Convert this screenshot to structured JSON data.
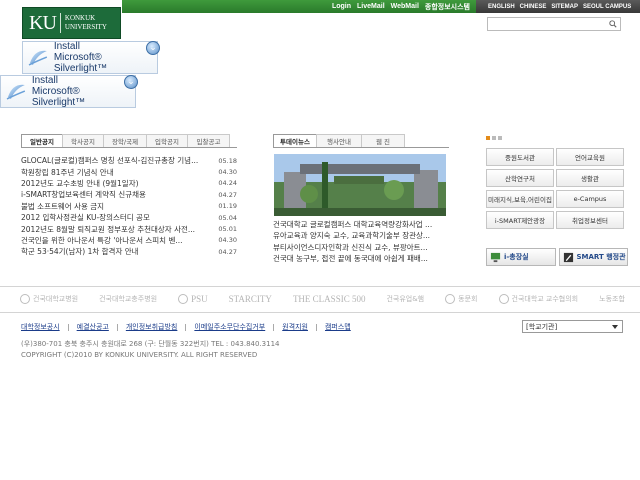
{
  "top_nav": {
    "links": [
      "Login",
      "LiveMail",
      "WebMail",
      "종합정보시스템"
    ],
    "lang_links": [
      "ENGLISH",
      "CHINESE",
      "SITEMAP",
      "SEOUL CAMPUS"
    ]
  },
  "logo": {
    "initials": "KU",
    "name_line1": "KONKUK",
    "name_line2": "UNIVERSITY"
  },
  "search": {
    "value": "",
    "placeholder": ""
  },
  "silverlight": {
    "line1": "Install",
    "line2": "Microsoft® Silverlight™"
  },
  "notice": {
    "tabs": [
      "일반공지",
      "학사공지",
      "장학/국제",
      "입학공지",
      "입찰공고"
    ],
    "items": [
      {
        "title": "GLOCAL(글로컬)캠퍼스 명칭 선포식-김진규총장 기념...",
        "date": "05.18"
      },
      {
        "title": "학원창립 81주년 기념식 안내",
        "date": "04.30"
      },
      {
        "title": "2012년도 교수초빙 안내 (9월1일자)",
        "date": "04.24"
      },
      {
        "title": "i-SMART창업보육센터 계약직 신규채용",
        "date": "04.27"
      },
      {
        "title": "불법 소프트웨어 사용 금지",
        "date": "01.19"
      },
      {
        "title": "2012 입학사정관실 KU-장의스터디 공모",
        "date": "05.04"
      },
      {
        "title": "2012년도 8월말 퇴직교원 정부포상 추천대상자 사전...",
        "date": "05.01"
      },
      {
        "title": "건국인을 위한 아나운서 특강 '아나운서 스피치 벤...",
        "date": "04.30"
      },
      {
        "title": "학군 53·54기(남자) 1차 합격자 안내",
        "date": "04.27"
      }
    ]
  },
  "tv": {
    "tabs": [
      "투데이뉴스",
      "행사안내",
      "웹 진"
    ],
    "items": [
      "건국대학교 글로컬캠퍼스 대학교육역량강화사업 ...",
      "유아교육과 양지숙 교수, 교육과학기술부 장관상...",
      "뷰티사이언스디자인학과 신진식 교수, 뷰팡아트...",
      "건국대 농구부, 접전 끝에 동국대에 아쉽게 패배..."
    ]
  },
  "quick_links": [
    "중원도서관",
    "언어교육원",
    "산학연구처",
    "생활관",
    "미래지식,보육,어린이집",
    "e-Campus",
    "i-SMART제안광장",
    "취업정보센터"
  ],
  "service_buttons": [
    "i-총장실",
    "SMART 행정관"
  ],
  "family_sites": [
    "건국대학교병원",
    "건국대학교충주병원",
    "PSU",
    "STARCITY",
    "THE CLASSIC 500",
    "건국유업&햄",
    "동문회",
    "건국대학교 교수협의회",
    "노동조합"
  ],
  "footer": {
    "links": [
      "대학정보공시",
      "예결산공고",
      "개인정보취급방침",
      "이메일주소무단수집거부",
      "원격지원",
      "캠퍼스맵"
    ],
    "select_value": "[학교기관]",
    "address": "(우)380-701 충북 충주시 충원대로 268 (구: 단월동 322번지) TEL : 043.840.3114",
    "copyright": "COPYRIGHT (C)2010 BY KONKUK UNIVERSITY. ALL RIGHT RESERVED"
  },
  "colors": {
    "top_green": "#2f8a31",
    "top_dark": "#404040",
    "logo_green": "#1d6b3a",
    "link_blue": "#1b3c8a"
  }
}
